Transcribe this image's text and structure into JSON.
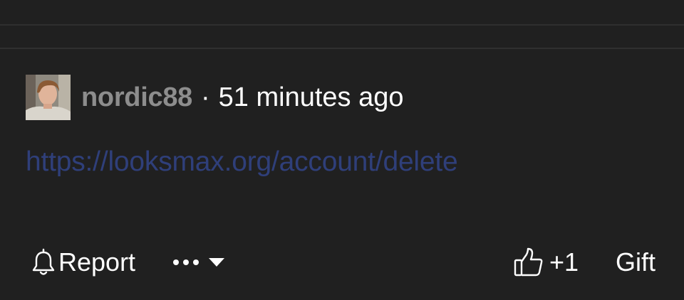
{
  "post": {
    "author": {
      "username": "nordic88"
    },
    "separator": "·",
    "timestamp": "51 minutes ago",
    "link": {
      "text": "https://looksmax.org/account/delete",
      "href": "https://looksmax.org/account/delete"
    }
  },
  "actions": {
    "report": {
      "label": "Report",
      "icon": "bell-icon"
    },
    "more": {
      "icon": "more-dots-icon",
      "caret_icon": "caret-down-icon"
    },
    "like": {
      "icon": "thumbs-up-icon",
      "count": "+1"
    },
    "gift": {
      "label": "Gift"
    }
  },
  "colors": {
    "background": "#202020",
    "divider": "#2f2f2f",
    "username": "#8d8d8d",
    "text": "#ffffff",
    "link": "#2f3f7a"
  }
}
